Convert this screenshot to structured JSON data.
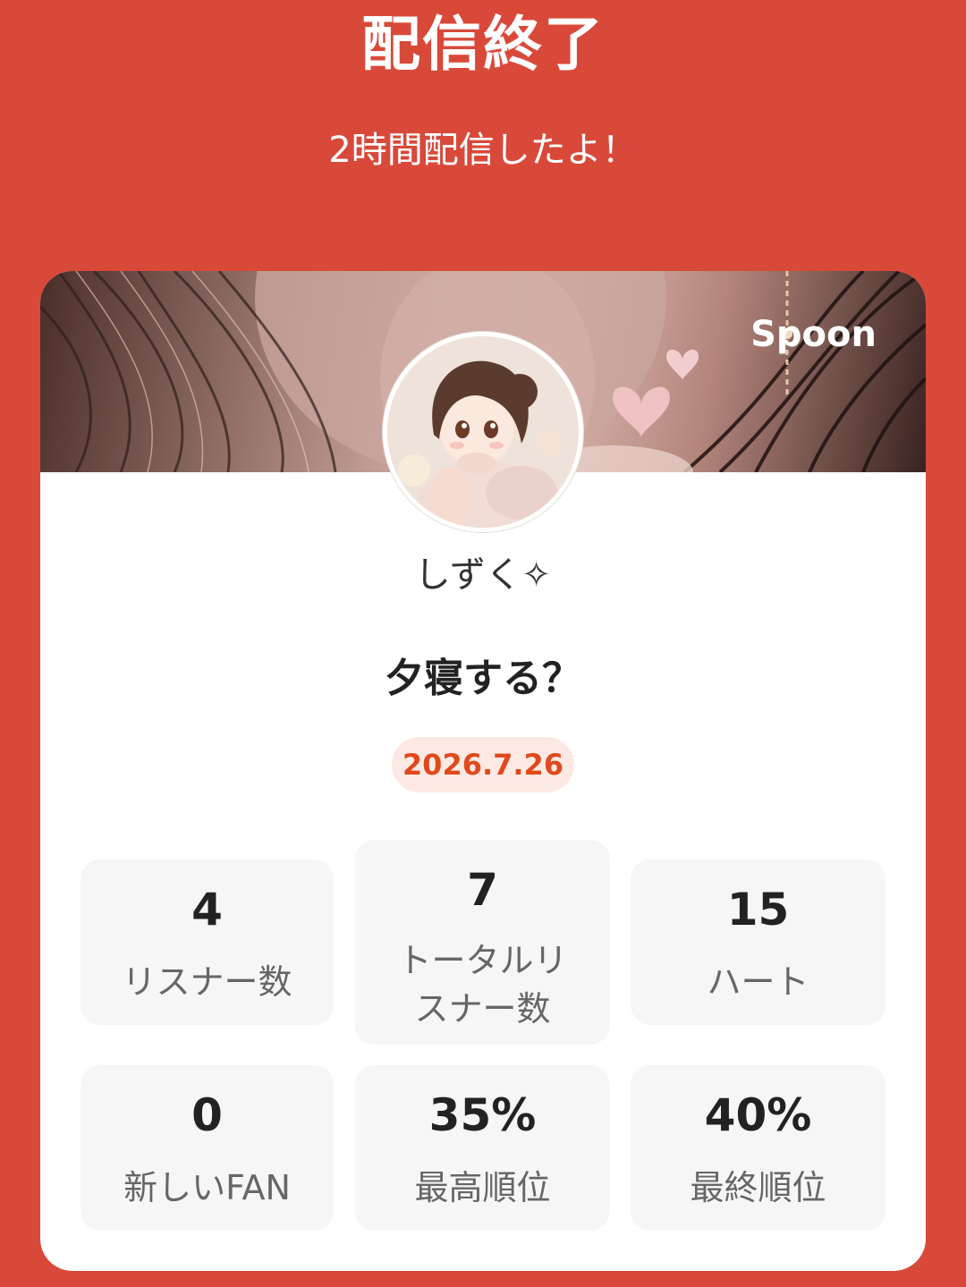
{
  "header": {
    "title": "配信終了",
    "subtitle": "2時間配信したよ！"
  },
  "card": {
    "brand": "Spoon",
    "username": "しずく✧",
    "stream_title": "夕寝する？",
    "date": "2026.7.26"
  },
  "stats": [
    {
      "value": "4",
      "label": "リスナー数"
    },
    {
      "value": "7",
      "label": "トータルリスナー数"
    },
    {
      "value": "15",
      "label": "ハート"
    },
    {
      "value": "0",
      "label": "新しいFAN"
    },
    {
      "value": "35%",
      "label": "最高順位"
    },
    {
      "value": "40%",
      "label": "最終順位"
    }
  ],
  "colors": {
    "background": "#d9493a",
    "date_text": "#e0491c",
    "date_badge": "#fde9e3",
    "stat_card": "#f6f6f6"
  }
}
